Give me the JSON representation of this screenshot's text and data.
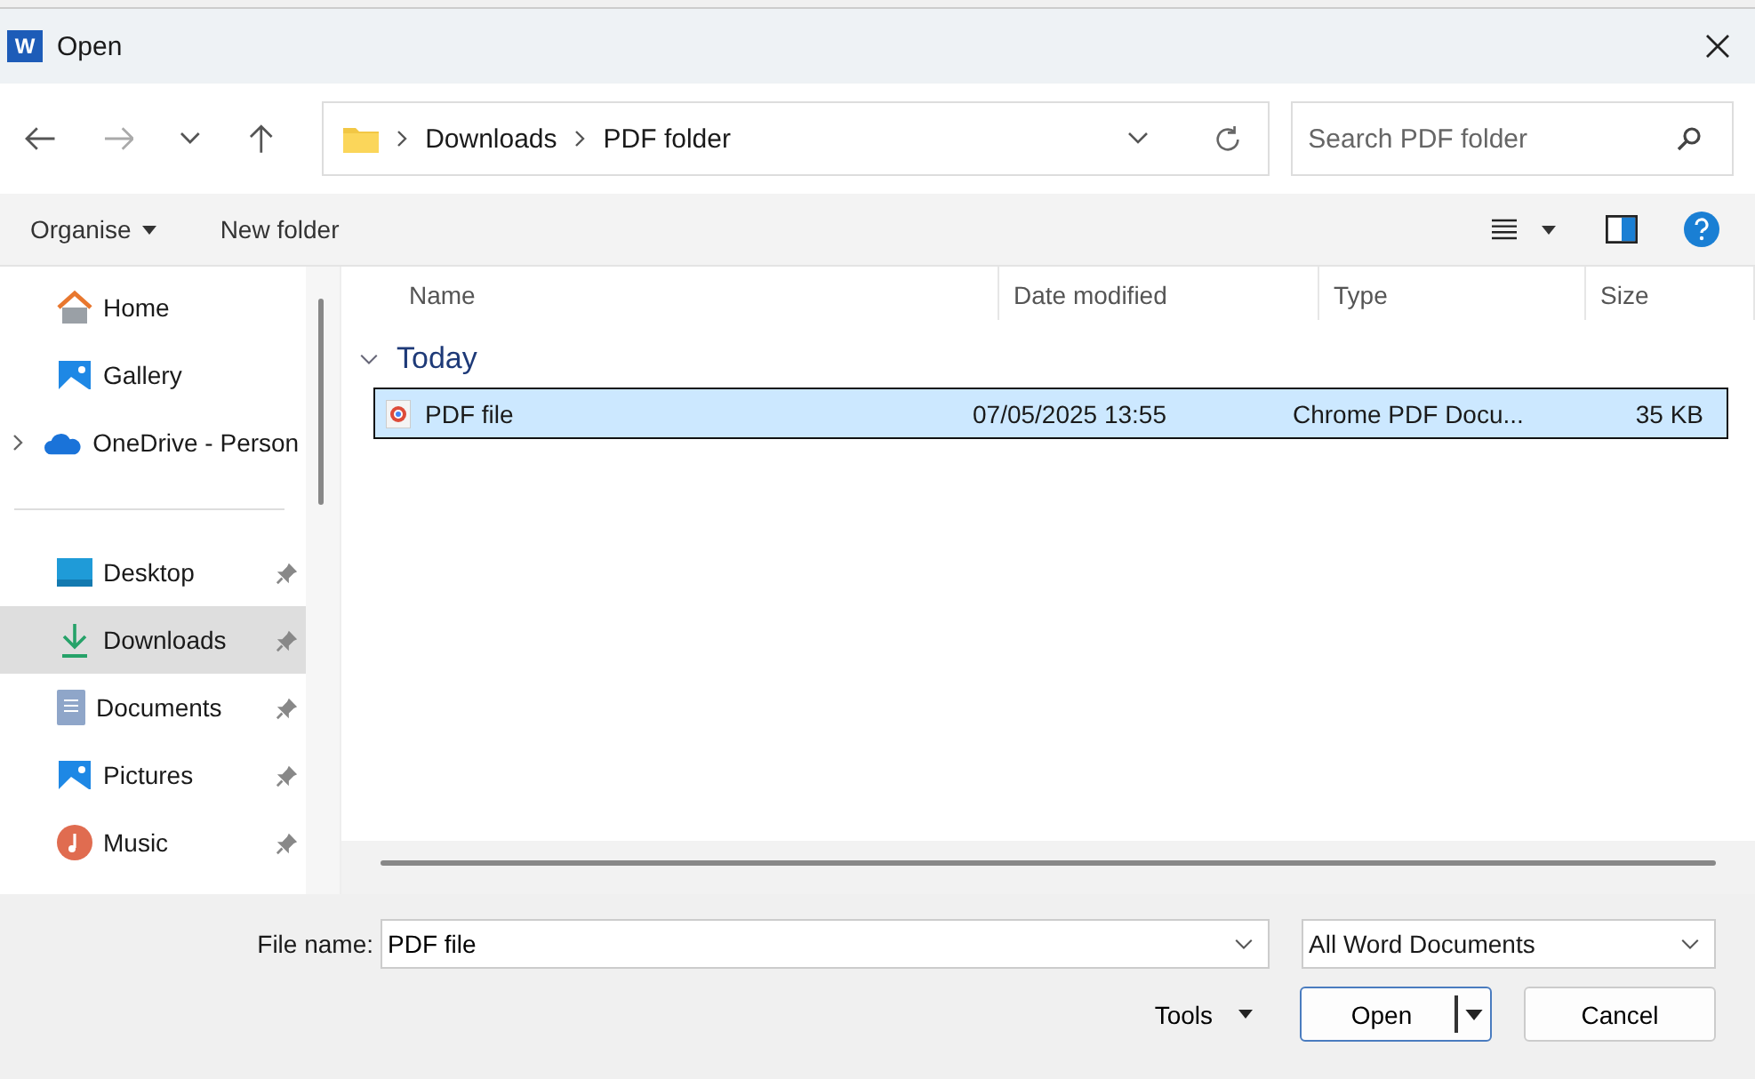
{
  "window": {
    "title": "Open",
    "app_icon_letter": "W"
  },
  "address_bar": {
    "crumbs": [
      "Downloads",
      "PDF folder"
    ]
  },
  "search": {
    "placeholder": "Search PDF folder"
  },
  "toolbar": {
    "organise": "Organise",
    "new_folder": "New folder"
  },
  "sidebar": {
    "sections": [
      {
        "items": [
          {
            "label": "Home",
            "kind": "home",
            "pinned": false,
            "selected": false,
            "expandable": false
          },
          {
            "label": "Gallery",
            "kind": "gallery",
            "pinned": false,
            "selected": false,
            "expandable": false
          },
          {
            "label": "OneDrive - Person",
            "kind": "cloud",
            "pinned": false,
            "selected": false,
            "expandable": true
          }
        ]
      },
      {
        "items": [
          {
            "label": "Desktop",
            "kind": "desktop",
            "pinned": true,
            "selected": false,
            "expandable": false
          },
          {
            "label": "Downloads",
            "kind": "download",
            "pinned": true,
            "selected": true,
            "expandable": false
          },
          {
            "label": "Documents",
            "kind": "document",
            "pinned": true,
            "selected": false,
            "expandable": false
          },
          {
            "label": "Pictures",
            "kind": "picture",
            "pinned": true,
            "selected": false,
            "expandable": false
          },
          {
            "label": "Music",
            "kind": "music",
            "pinned": true,
            "selected": false,
            "expandable": false
          }
        ]
      }
    ]
  },
  "table": {
    "columns": [
      "Name",
      "Date modified",
      "Type",
      "Size"
    ],
    "groups": [
      {
        "label": "Today",
        "expanded": true,
        "rows": [
          {
            "name": "PDF file",
            "date": "07/05/2025 13:55",
            "type": "Chrome PDF Docu...",
            "size": "35 KB",
            "selected": true
          }
        ]
      }
    ]
  },
  "footer": {
    "file_name_label": "File name:",
    "file_name": "PDF file",
    "filter": "All Word Documents",
    "tools": "Tools",
    "open": "Open",
    "cancel": "Cancel"
  }
}
